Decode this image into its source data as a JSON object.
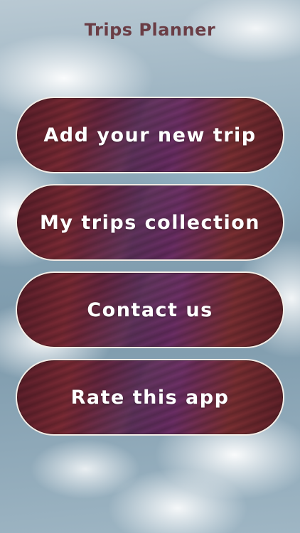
{
  "app": {
    "title": "Trips Planner"
  },
  "menu": {
    "items": [
      {
        "label": "Add your new trip"
      },
      {
        "label": "My trips collection"
      },
      {
        "label": "Contact us"
      },
      {
        "label": "Rate this app"
      }
    ]
  },
  "colors": {
    "title_text": "#6a3d45",
    "button_text": "#ffffff",
    "button_border": "#f3ece6",
    "button_fill_dark": "#5a1e2a",
    "button_fill_purple": "#4e2350",
    "sky_blue": "#7d9aac"
  }
}
